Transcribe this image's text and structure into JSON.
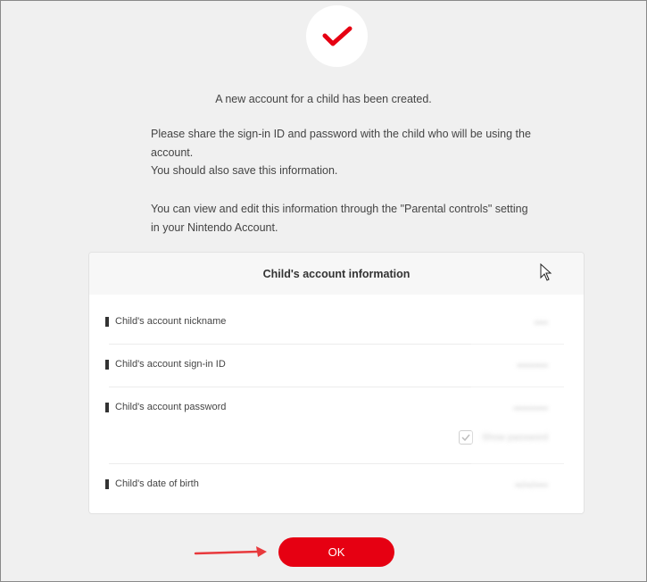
{
  "message": {
    "headline": "A new account for a child has been created.",
    "line1": "Please share the sign-in ID and password with the child who will be using the account.",
    "line2": "You should also save this information.",
    "line3": "You can view and edit this information through the \"Parental controls\" setting in your Nintendo Account."
  },
  "card": {
    "title": "Child's account information",
    "rows": [
      {
        "label": "Child's account nickname",
        "value": "••••"
      },
      {
        "label": "Child's account sign-in ID",
        "value": "•••••••••"
      },
      {
        "label": "Child's account password",
        "value": "••••••••••"
      },
      {
        "label": "Child's date of birth",
        "value": "••/••/••••"
      }
    ],
    "show_password_label": "Show password"
  },
  "actions": {
    "ok_label": "OK"
  },
  "colors": {
    "accent": "#e60012",
    "background": "#f0f0f0",
    "card_header": "#f7f7f7"
  },
  "icons": {
    "success": "checkmark-icon",
    "cursor": "mouse-pointer-icon",
    "pointer": "red-arrow-icon"
  }
}
